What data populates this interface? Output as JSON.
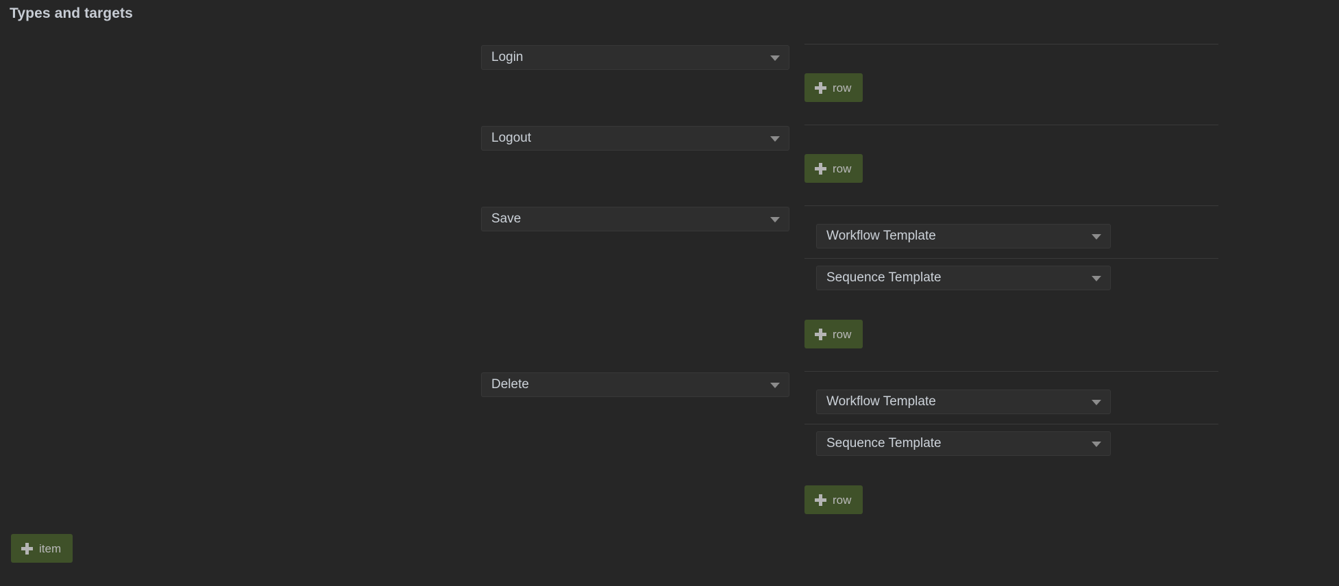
{
  "page": {
    "title": "Types and targets",
    "background_color": "#262626",
    "accent_color": "#3f5129"
  },
  "add_item_button": {
    "label": "item",
    "icon": "plus-icon"
  },
  "groups": [
    {
      "type": {
        "value": "Login",
        "icon": "chevron-down-icon"
      },
      "targets": [],
      "add_row_button": {
        "label": "row",
        "icon": "plus-icon"
      }
    },
    {
      "type": {
        "value": "Logout",
        "icon": "chevron-down-icon"
      },
      "targets": [],
      "add_row_button": {
        "label": "row",
        "icon": "plus-icon"
      }
    },
    {
      "type": {
        "value": "Save",
        "icon": "chevron-down-icon"
      },
      "targets": [
        {
          "value": "Workflow Template",
          "icon": "chevron-down-icon"
        },
        {
          "value": "Sequence Template",
          "icon": "chevron-down-icon"
        }
      ],
      "add_row_button": {
        "label": "row",
        "icon": "plus-icon"
      }
    },
    {
      "type": {
        "value": "Delete",
        "icon": "chevron-down-icon"
      },
      "targets": [
        {
          "value": "Workflow Template",
          "icon": "chevron-down-icon"
        },
        {
          "value": "Sequence Template",
          "icon": "chevron-down-icon"
        }
      ],
      "add_row_button": {
        "label": "row",
        "icon": "plus-icon"
      }
    }
  ]
}
